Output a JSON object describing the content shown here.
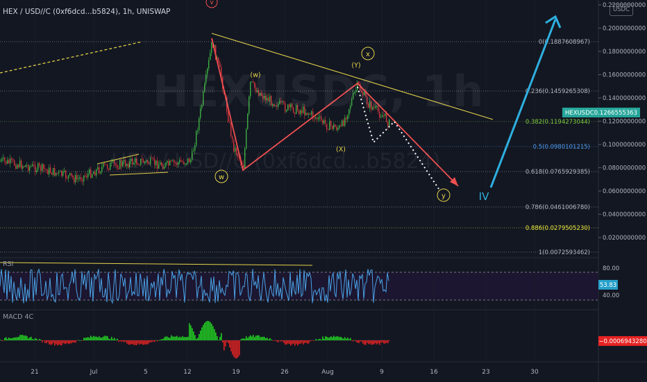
{
  "header": {
    "title": "HEX / USD//C (0xf6dcd...b5824), 1h, UNISWAP",
    "currency_button": "USDC"
  },
  "watermark": {
    "symbol": "HEXUSDC, 1h",
    "name": "HEX / USD//C (0xf6dcd...b5824)"
  },
  "price_axis": {
    "ticks": [
      "0.2200000000",
      "0.2000000000",
      "0.1800000000",
      "0.1600000000",
      "0.1400000000",
      "0.1200000000",
      "0.1000000000",
      "0.0800000000",
      "0.0600000000",
      "0.0400000000",
      "0.0200000000"
    ],
    "current_tag": "0.1266555363",
    "symbol_tag": "HEXUSDC"
  },
  "fib_levels": [
    {
      "ratio": "0",
      "price": "(0.1887608967)",
      "color": "#b2b5be"
    },
    {
      "ratio": "0.236",
      "price": "(0.1459265308)",
      "color": "#b2b5be"
    },
    {
      "ratio": "0.382",
      "price": "(0.1194273044)",
      "color": "#7ecb3c"
    },
    {
      "ratio": "0.5",
      "price": "(0.0980101215)",
      "color": "#4f9cf0"
    },
    {
      "ratio": "0.618",
      "price": "(0.0765929385)",
      "color": "#b2b5be"
    },
    {
      "ratio": "0.786",
      "price": "(0.0461006780)",
      "color": "#b2b5be"
    },
    {
      "ratio": "0.886",
      "price": "(0.0279505230)",
      "color": "#e8e83c"
    },
    {
      "ratio": "1",
      "price": "(0.0072593462)",
      "color": "#b2b5be"
    }
  ],
  "wave_labels": {
    "v": "v",
    "w_paren": "(w)",
    "w": "w",
    "x": "x",
    "y_paren": "(Y)",
    "x_paren": "(X)",
    "y": "y",
    "iv": "IV"
  },
  "rsi": {
    "label": "RSI",
    "ticks": [
      "80.00",
      "40.00"
    ],
    "value": "53.83"
  },
  "macd": {
    "label": "MACD 4C",
    "value": "−0.0006943280"
  },
  "time_axis": {
    "labels": [
      "21",
      "Jul",
      "5",
      "12",
      "19",
      "26",
      "Aug",
      "9",
      "16",
      "23",
      "30"
    ]
  },
  "colors": {
    "background": "#131722",
    "candle_up": "#3cb043",
    "candle_down": "#d0343c",
    "wave_red": "#f05050",
    "trend_yellow": "#e6d34a",
    "projection_blue": "#2eb0e0",
    "rsi_line": "#4aa3e8",
    "macd_up": "#22cc22",
    "macd_down": "#dd2222",
    "current_price_bg": "#26a69a"
  }
}
